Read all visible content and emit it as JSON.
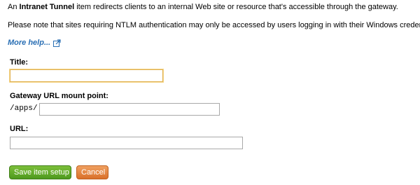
{
  "intro": {
    "prefix": "An ",
    "bold": "Intranet Tunnel",
    "suffix": " item redirects clients to an internal Web site or resource that's accessible through the gateway."
  },
  "note": "Please note that sites requiring NTLM authentication may only be accessed by users logging in with their Windows credentials.",
  "more_help": {
    "label": "More help...",
    "icon": "external-link-icon",
    "color": "#2a6fb4"
  },
  "form": {
    "title_label": "Title:",
    "title_value": "",
    "mount_label": "Gateway URL mount point:",
    "mount_prefix": "/apps/",
    "mount_value": "",
    "url_label": "URL:",
    "url_value": ""
  },
  "buttons": {
    "save": "Save item setup",
    "cancel": "Cancel",
    "save_color": "#5ea82a",
    "cancel_color": "#e4813d"
  }
}
